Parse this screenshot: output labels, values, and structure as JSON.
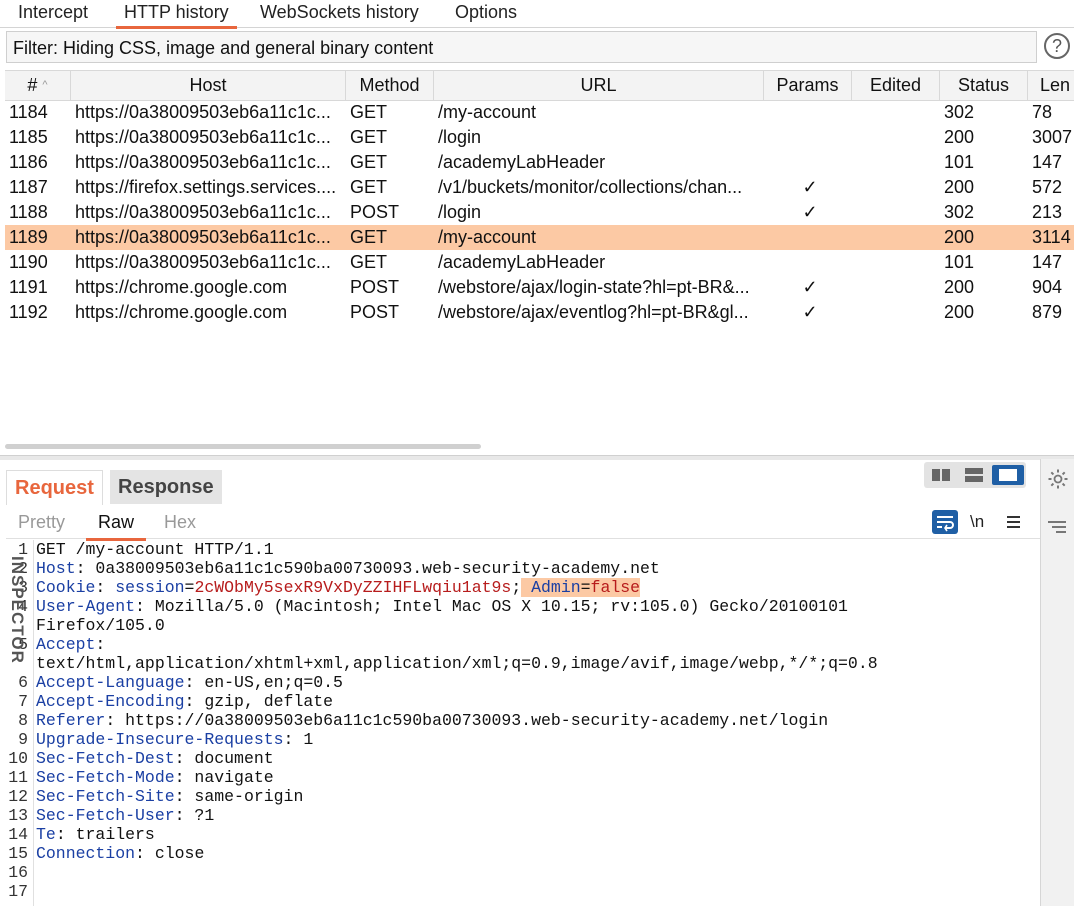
{
  "tabs": [
    "Intercept",
    "HTTP history",
    "WebSockets history",
    "Options"
  ],
  "filter": {
    "text": "Filter: Hiding CSS, image and general binary content",
    "help": "?"
  },
  "table": {
    "columns": [
      "#",
      "Host",
      "Method",
      "URL",
      "Params",
      "Edited",
      "Status",
      "Len"
    ],
    "sort_glyph": "^",
    "check_glyph": "✓",
    "rows": [
      {
        "num": "1184",
        "host": "https://0a38009503eb6a11c1c...",
        "method": "GET",
        "url": "/my-account",
        "params": "",
        "status": "302",
        "len": "78"
      },
      {
        "num": "1185",
        "host": "https://0a38009503eb6a11c1c...",
        "method": "GET",
        "url": "/login",
        "params": "",
        "status": "200",
        "len": "3007"
      },
      {
        "num": "1186",
        "host": "https://0a38009503eb6a11c1c...",
        "method": "GET",
        "url": "/academyLabHeader",
        "params": "",
        "status": "101",
        "len": "147"
      },
      {
        "num": "1187",
        "host": "https://firefox.settings.services....",
        "method": "GET",
        "url": "/v1/buckets/monitor/collections/chan...",
        "params": "✓",
        "status": "200",
        "len": "572"
      },
      {
        "num": "1188",
        "host": "https://0a38009503eb6a11c1c...",
        "method": "POST",
        "url": "/login",
        "params": "✓",
        "status": "302",
        "len": "213"
      },
      {
        "num": "1189",
        "host": "https://0a38009503eb6a11c1c...",
        "method": "GET",
        "url": "/my-account",
        "params": "",
        "status": "200",
        "len": "3114"
      },
      {
        "num": "1190",
        "host": "https://0a38009503eb6a11c1c...",
        "method": "GET",
        "url": "/academyLabHeader",
        "params": "",
        "status": "101",
        "len": "147"
      },
      {
        "num": "1191",
        "host": "https://chrome.google.com",
        "method": "POST",
        "url": "/webstore/ajax/login-state?hl=pt-BR&...",
        "params": "✓",
        "status": "200",
        "len": "904"
      },
      {
        "num": "1192",
        "host": "https://chrome.google.com",
        "method": "POST",
        "url": "/webstore/ajax/eventlog?hl=pt-BR&gl...",
        "params": "✓",
        "status": "200",
        "len": "879"
      }
    ]
  },
  "message_tabs": {
    "request": "Request",
    "response": "Response"
  },
  "view_tabs": {
    "pretty": "Pretty",
    "raw": "Raw",
    "hex": "Hex",
    "newline": "\\n"
  },
  "inspector": "INSPECTOR",
  "request": {
    "line1": "GET /my-account HTTP/1.1",
    "host_key": "Host",
    "host_val": " 0a38009503eb6a11c1c590ba00730093.web-security-academy.net",
    "cookie_key": "Cookie",
    "cookie_name": "session",
    "cookie_value": "2cWObMy5sexR9VxDyZZIHFLwqiu1at9s",
    "admin_key": "Admin",
    "admin_value": "false",
    "ua_key": "User-Agent",
    "ua_val": " Mozilla/5.0 (Macintosh; Intel Mac OS X 10.15; rv:105.0) Gecko/20100101",
    "ua_cont": "Firefox/105.0",
    "accept_key": "Accept",
    "accept_val": "text/html,application/xhtml+xml,application/xml;q=0.9,image/avif,image/webp,*/*;q=0.8",
    "al_key": "Accept-Language",
    "al_val": " en-US,en;q=0.5",
    "ae_key": "Accept-Encoding",
    "ae_val": " gzip, deflate",
    "ref_key": "Referer",
    "ref_val": " https://0a38009503eb6a11c1c590ba00730093.web-security-academy.net/login",
    "uir_key": "Upgrade-Insecure-Requests",
    "uir_val": " 1",
    "sfd_key": "Sec-Fetch-Dest",
    "sfd_val": " document",
    "sfm_key": "Sec-Fetch-Mode",
    "sfm_val": " navigate",
    "sfs_key": "Sec-Fetch-Site",
    "sfs_val": " same-origin",
    "sfu_key": "Sec-Fetch-User",
    "sfu_val": " ?1",
    "te_key": "Te",
    "te_val": " trailers",
    "conn_key": "Connection",
    "conn_val": " close",
    "line_numbers": [
      "1",
      "2",
      "3",
      "4",
      "",
      "5",
      "",
      "6",
      "7",
      "8",
      "9",
      "10",
      "11",
      "12",
      "13",
      "14",
      "15",
      "16",
      "17"
    ]
  },
  "colors": {
    "accent": "#e8663d",
    "selected_row": "#fcc9a4",
    "header_key": "#1a3fa3",
    "cookie_value": "#b71c1c"
  }
}
